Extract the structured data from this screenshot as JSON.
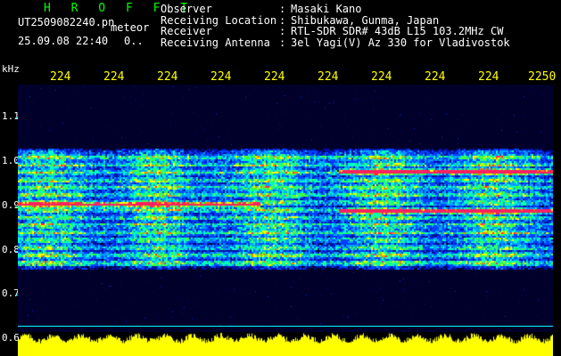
{
  "header": {
    "brand": "H R O F F T",
    "filename": "UT2509082240.pn",
    "meteor_label": "meteor",
    "datetime": "25.09.08 22:40",
    "count": "0.."
  },
  "info": [
    {
      "label": "Observer",
      "value": "Masaki Kano"
    },
    {
      "label": "Receiving Location",
      "value": "Shibukawa, Gunma, Japan"
    },
    {
      "label": "Receiver",
      "value": "RTL-SDR SDR# 43dB L15 103.2MHz CW"
    },
    {
      "label": "Receiving Antenna",
      "value": "3el Yagi(V) Az 330 for Vladivostok"
    }
  ],
  "separator": ":",
  "chart_data": {
    "type": "heatmap",
    "ylabel": "kHz",
    "x_tick_labels": [
      "224",
      "224",
      "224",
      "224",
      "224",
      "224",
      "224",
      "224",
      "224",
      "2250"
    ],
    "y_tick_labels": [
      "1.1",
      "1.0",
      "0.9",
      "0.8",
      "0.7",
      "0.6"
    ],
    "y_ticks": [
      1.1,
      1.0,
      0.9,
      0.8,
      0.7,
      0.6
    ],
    "ylim": [
      0.59,
      1.15
    ],
    "signal_band": [
      0.76,
      1.03
    ],
    "strong_traces": [
      {
        "freq": 0.905,
        "from": 0.0,
        "to": 0.45
      },
      {
        "freq": 0.89,
        "from": 0.6,
        "to": 1.0
      },
      {
        "freq": 0.98,
        "from": 0.6,
        "to": 1.0
      }
    ]
  },
  "colors": {
    "brand": "#00ff00",
    "text": "#ffffff",
    "ticks": "#ffff00",
    "axis": "#00ffff",
    "power": "#ffff00",
    "baseline": "#00ffff"
  }
}
